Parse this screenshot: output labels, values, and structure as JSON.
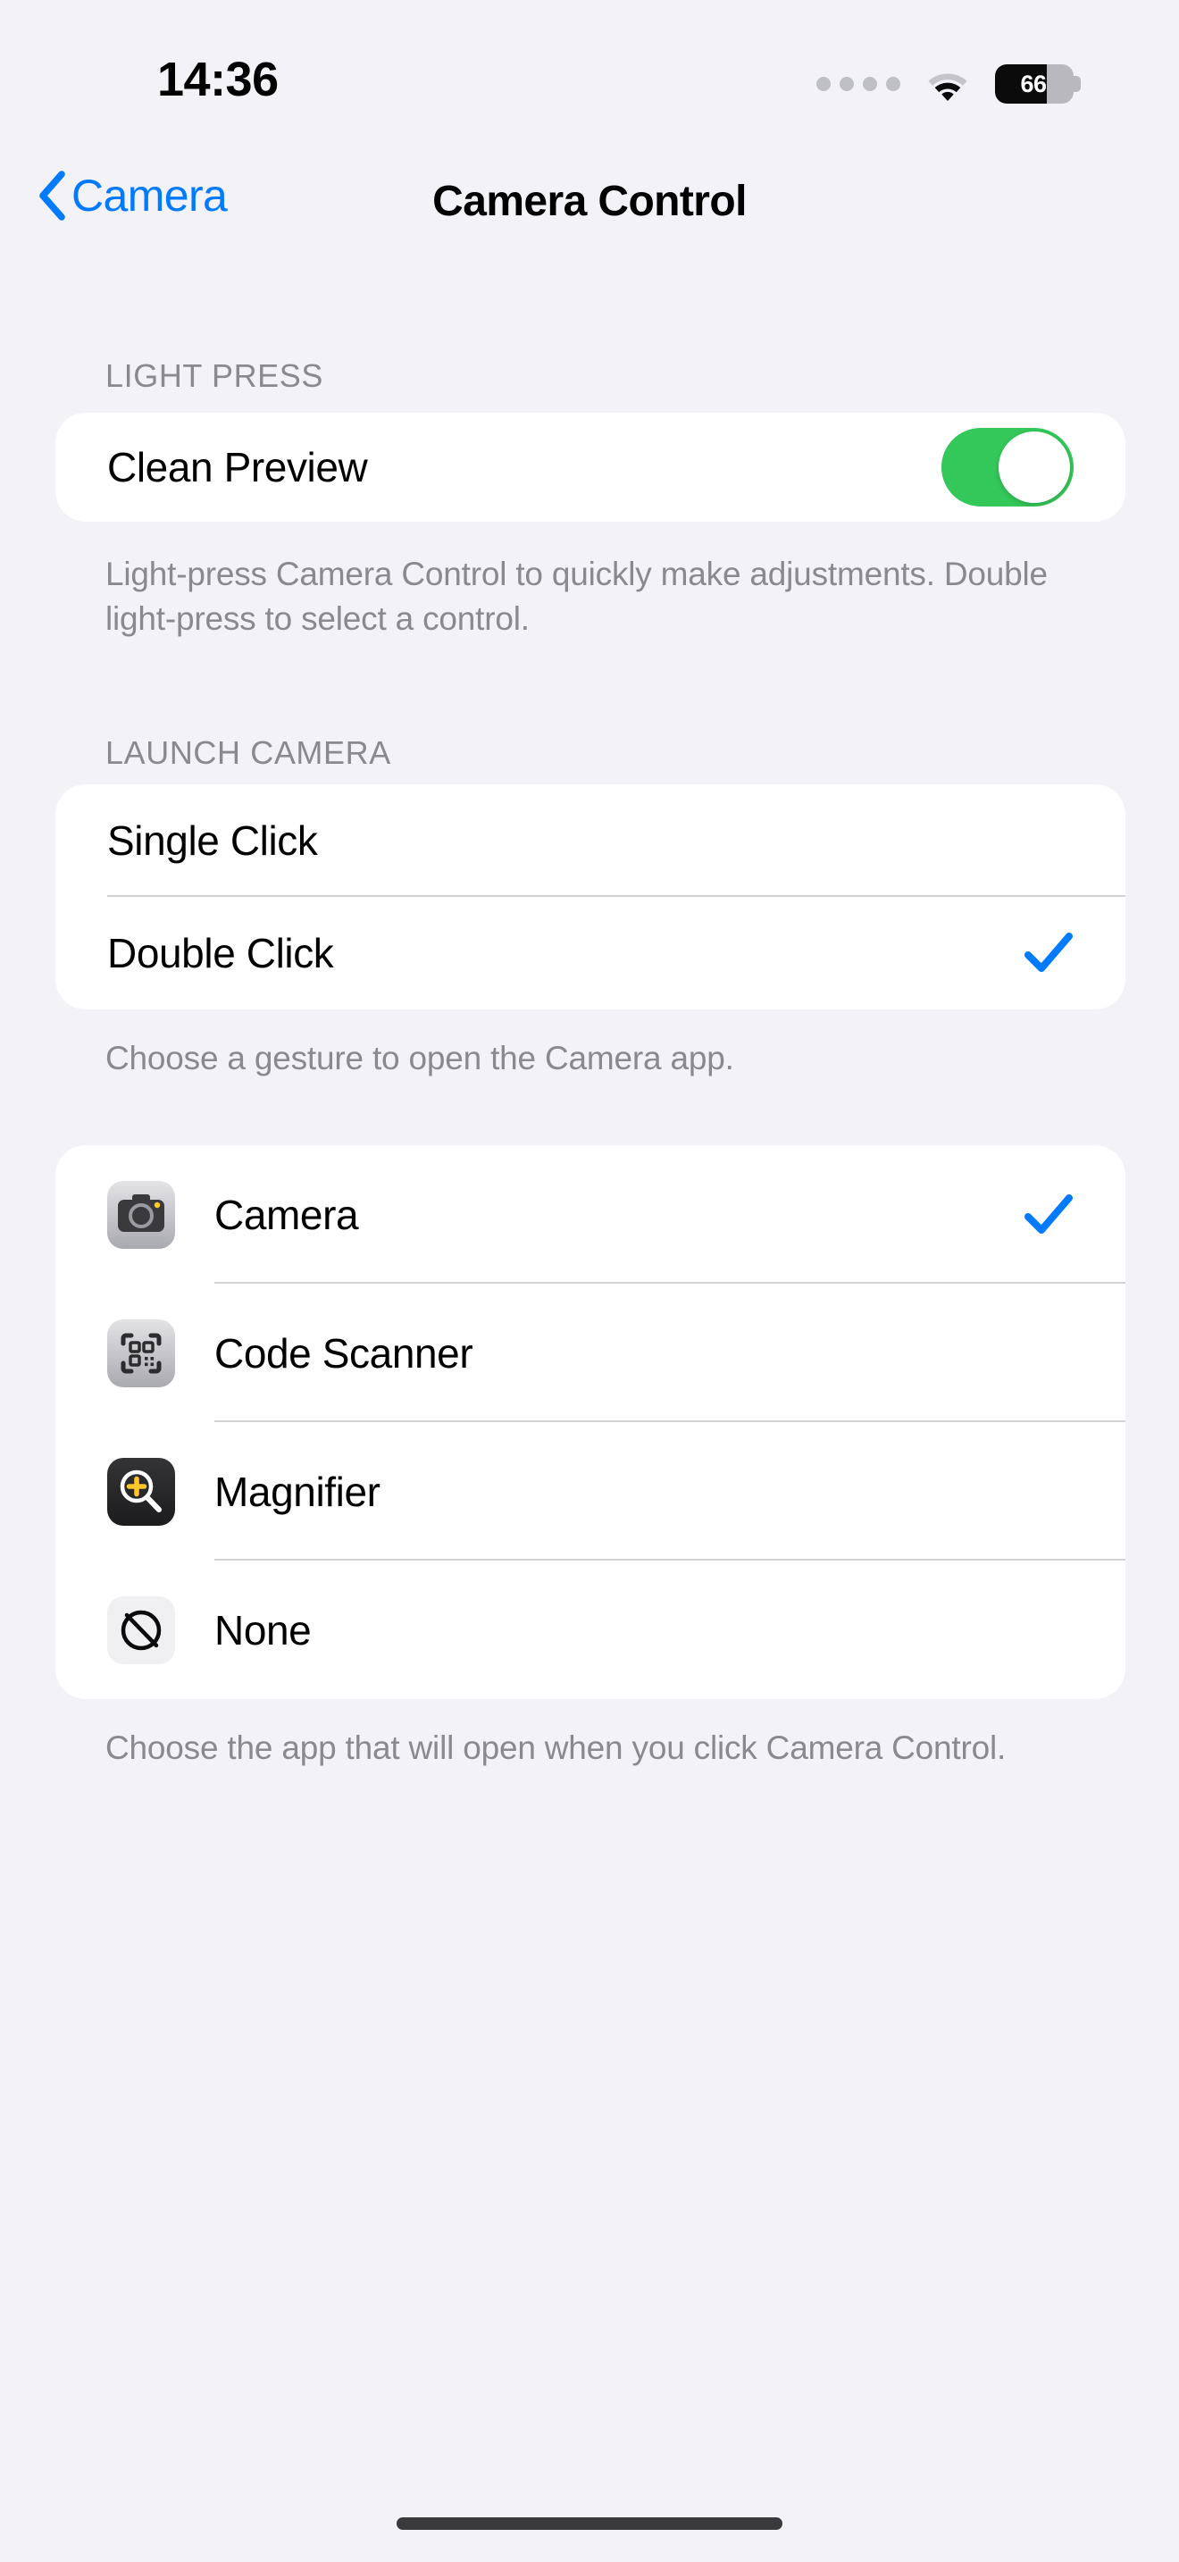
{
  "status_bar": {
    "time": "14:36",
    "battery_percent": "66",
    "battery_level": 66,
    "wifi_icon": "wifi-icon",
    "signal_icon": "signal-dots-icon",
    "battery_icon": "battery-icon"
  },
  "nav": {
    "back_label": "Camera",
    "back_icon": "chevron-left-icon",
    "title": "Camera Control"
  },
  "sections": {
    "light_press": {
      "header": "LIGHT PRESS",
      "rows": [
        {
          "label": "Clean Preview",
          "toggle_on": true
        }
      ],
      "footer": "Light-press Camera Control to quickly make adjustments. Double light-press to select a control."
    },
    "launch_camera": {
      "header": "LAUNCH CAMERA",
      "rows": [
        {
          "label": "Single Click",
          "selected": false
        },
        {
          "label": "Double Click",
          "selected": true
        }
      ],
      "footer": "Choose a gesture to open the Camera app."
    },
    "app_choice": {
      "header": "",
      "rows": [
        {
          "label": "Camera",
          "icon": "camera-app-icon",
          "selected": true
        },
        {
          "label": "Code Scanner",
          "icon": "code-scanner-app-icon",
          "selected": false
        },
        {
          "label": "Magnifier",
          "icon": "magnifier-app-icon",
          "selected": false
        },
        {
          "label": "None",
          "icon": "none-slash-icon",
          "selected": false
        }
      ],
      "footer": "Choose the app that will open when you click Camera Control."
    }
  },
  "colors": {
    "accent_blue": "#007AFF",
    "toggle_green": "#34C759",
    "page_background": "#F2F2F7",
    "card_background": "#FFFFFF",
    "secondary_text": "#8A8A8E",
    "separator": "#D3D3D6",
    "magnifier_yellow": "#FFC72C"
  }
}
